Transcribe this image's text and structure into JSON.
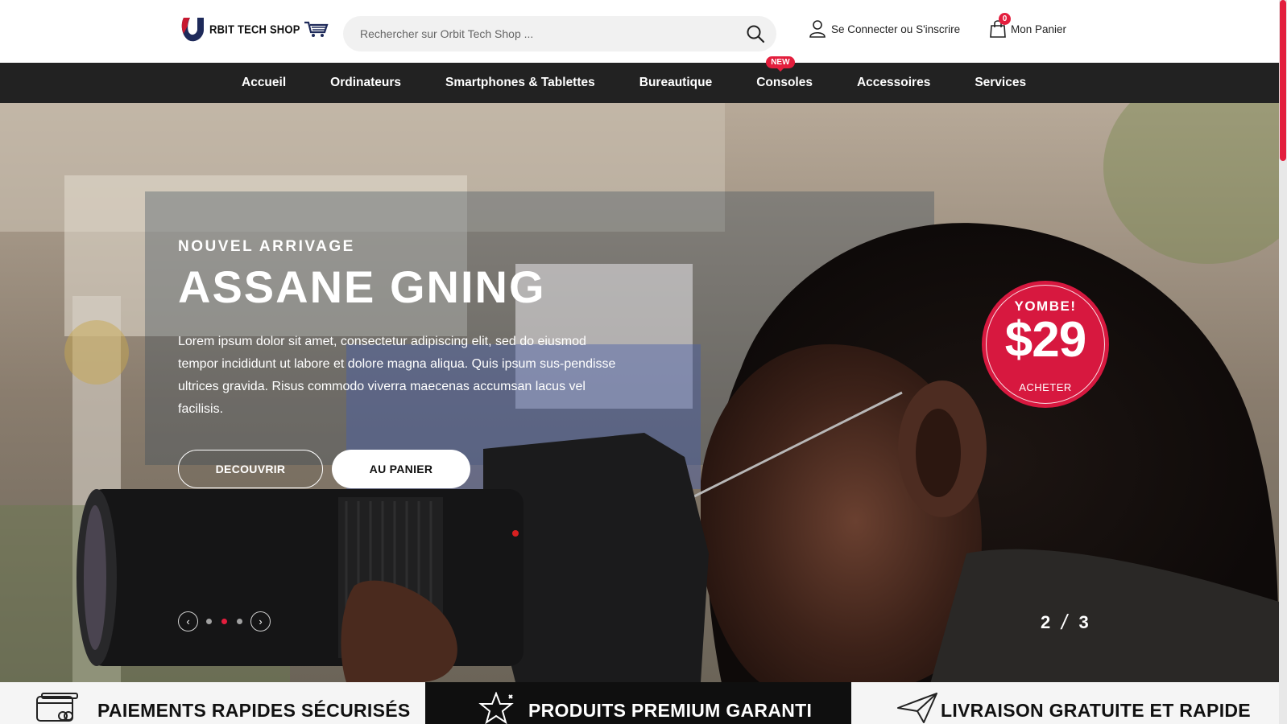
{
  "header": {
    "logo_text": "RBIT TECH SHOP",
    "search_placeholder": "Rechercher sur Orbit Tech Shop ...",
    "account_label": "Se Connecter ou S'inscrire",
    "cart_label": "Mon Panier",
    "cart_count": "0"
  },
  "nav": {
    "items": [
      {
        "label": "Accueil"
      },
      {
        "label": "Ordinateurs"
      },
      {
        "label": "Smartphones & Tablettes"
      },
      {
        "label": "Bureautique"
      },
      {
        "label": "Consoles",
        "badge": "NEW"
      },
      {
        "label": "Accessoires"
      },
      {
        "label": "Services"
      }
    ]
  },
  "hero": {
    "eyebrow": "NOUVEL ARRIVAGE",
    "title": "ASSANE GNING",
    "description": "Lorem ipsum dolor sit amet, consectetur adipiscing elit, sed do eiusmod tempor incididunt ut labore et dolore magna aliqua. Quis ipsum sus-pendisse ultrices gravida. Risus commodo viverra maecenas accumsan lacus vel facilisis.",
    "btn_discover": "DECOUVRIR",
    "btn_cart": "AU PANIER",
    "current_slide": "2",
    "total_slides": "3",
    "badge": {
      "top": "YOMBE!",
      "price": "$29",
      "cta": "ACHETER"
    }
  },
  "features": [
    {
      "label": "PAIEMENTS RAPIDES SÉCURISÉS",
      "icon": "credit-card-icon"
    },
    {
      "label": "PRODUITS PREMIUM GARANTI",
      "icon": "star-icon"
    },
    {
      "label": "LIVRAISON GRATUITE ET RAPIDE",
      "icon": "paper-plane-icon"
    }
  ],
  "colors": {
    "accent": "#e31e3d",
    "nav_bg": "#222222",
    "dark_feature": "#0f0f0f"
  }
}
